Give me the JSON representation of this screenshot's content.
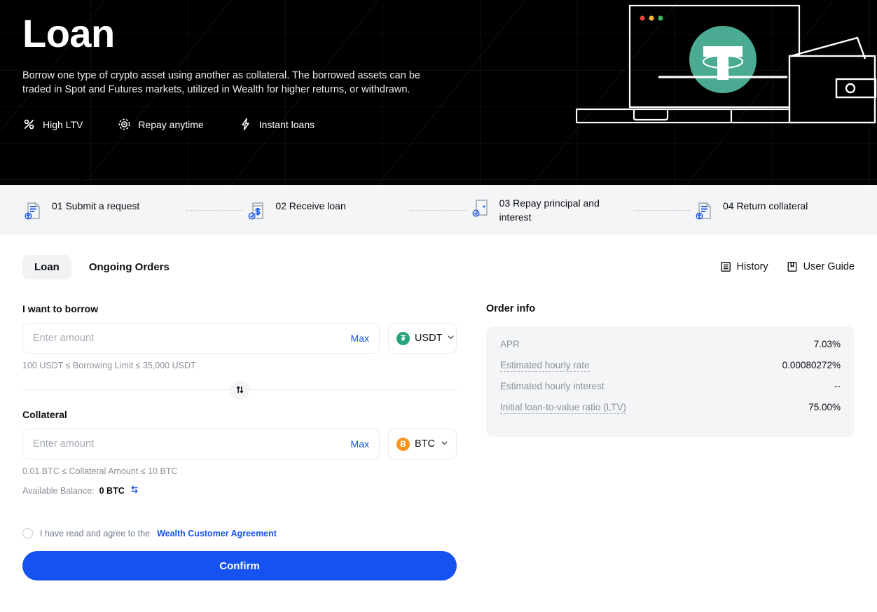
{
  "hero": {
    "title": "Loan",
    "description": "Borrow one type of crypto asset using another as collateral. The borrowed assets can be traded in Spot and Futures markets, utilized in Wealth for higher returns, or withdrawn.",
    "features": [
      {
        "icon": "percent-icon",
        "label": "High LTV"
      },
      {
        "icon": "clock-target-icon",
        "label": "Repay anytime"
      },
      {
        "icon": "lightning-icon",
        "label": "Instant loans"
      }
    ],
    "illustration": {
      "laptop_dots": [
        "#e0443e",
        "#f6b83f",
        "#3bb662"
      ],
      "token_badge": "USDT",
      "token_color": "#4aab92"
    },
    "background_color": "#000000"
  },
  "steps": [
    {
      "icon": "document-upload-icon",
      "text": "01 Submit a request"
    },
    {
      "icon": "receipt-dollar-icon",
      "text": "02 Receive loan"
    },
    {
      "icon": "repay-check-icon",
      "text": "03 Repay principal and interest"
    },
    {
      "icon": "document-upload-icon",
      "text": "04 Return collateral"
    }
  ],
  "tabs": [
    {
      "label": "Loan",
      "active": true
    },
    {
      "label": "Ongoing Orders",
      "active": false
    }
  ],
  "header_actions": [
    {
      "icon": "history-icon",
      "label": "History"
    },
    {
      "icon": "book-icon",
      "label": "User Guide"
    }
  ],
  "borrow": {
    "section_label": "I want to borrow",
    "input_value": "",
    "placeholder": "Enter amount",
    "max_label": "Max",
    "token": "USDT",
    "token_symbol": "₮",
    "token_color": "#26a17b",
    "hint": "100 USDT ≤ Borrowing Limit ≤ 35,000 USDT"
  },
  "collateral": {
    "section_label": "Collateral",
    "input_value": "",
    "placeholder": "Enter amount",
    "max_label": "Max",
    "token": "BTC",
    "token_symbol": "Ƀ",
    "token_color": "#f7931a",
    "hint": "0.01 BTC ≤ Collateral Amount ≤ 10 BTC",
    "balance_label": "Available Balance:",
    "balance_value": "0 BTC",
    "transfer_icon": "transfer-icon"
  },
  "agreement": {
    "checked": false,
    "text": "I have read and agree to the",
    "link": "Wealth Customer Agreement"
  },
  "confirm": {
    "label": "Confirm",
    "color": "#1652f0"
  },
  "order_info": {
    "title": "Order info",
    "rows": [
      {
        "key": "APR",
        "value": "7.03%",
        "tooltip": false
      },
      {
        "key": "Estimated hourly rate",
        "value": "0.00080272%",
        "tooltip": true
      },
      {
        "key": "Estimated hourly interest",
        "value": "--",
        "tooltip": false
      },
      {
        "key": "Initial loan-to-value ratio (LTV)",
        "value": "75.00%",
        "tooltip": true
      }
    ]
  }
}
